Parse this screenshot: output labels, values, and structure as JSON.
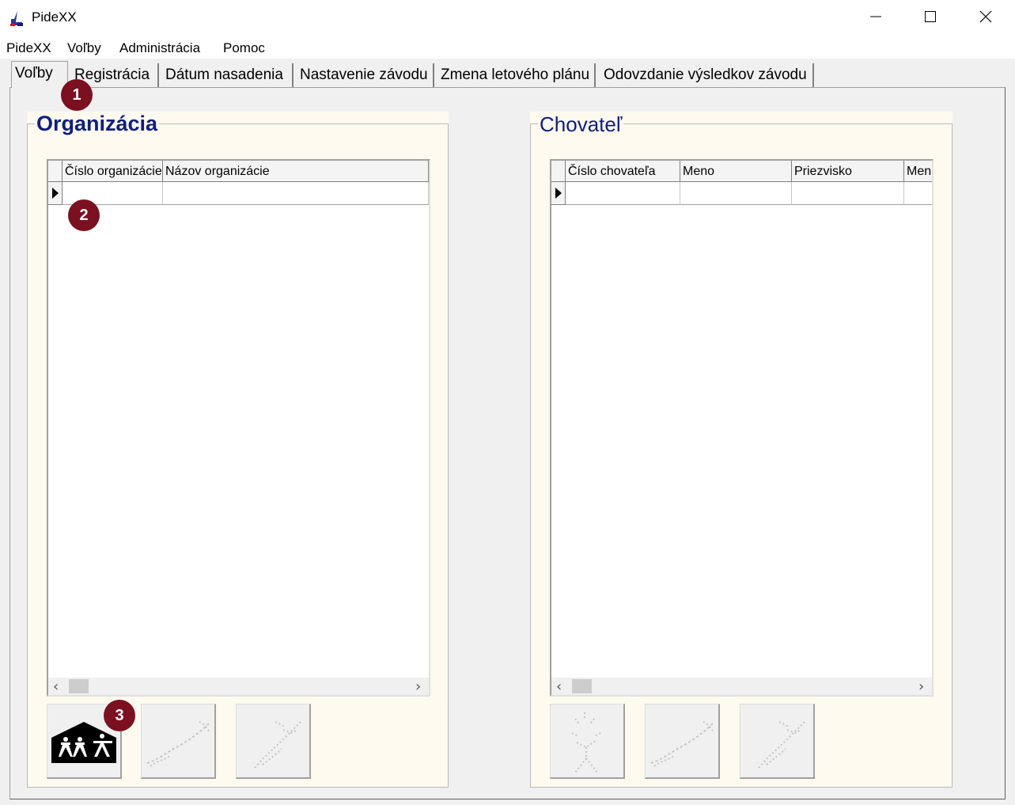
{
  "window": {
    "title": "PideXX",
    "minimize_icon": "minimize-icon",
    "maximize_icon": "maximize-icon",
    "close_icon": "close-icon"
  },
  "menu": [
    "PideXX",
    "Voľby",
    "Administrácia",
    "Pomoc"
  ],
  "tabs": [
    {
      "label": "Voľby",
      "active": true
    },
    {
      "label": "Registrácia"
    },
    {
      "label": "Dátum nasadenia"
    },
    {
      "label": "Nastavenie závodu"
    },
    {
      "label": "Zmena letového plánu"
    },
    {
      "label": "Odovzdanie výsledkov závodu"
    }
  ],
  "organizacia": {
    "title": "Organizácia",
    "columns": [
      "Číslo organizácie",
      "Názov organizácie"
    ],
    "buttons": [
      "add-organization-icon",
      "pigeon-icon",
      "bird-flight-icon"
    ]
  },
  "chovatel": {
    "title": "Chovateľ",
    "columns": [
      "Číslo chovateľa",
      "Meno",
      "Priezvisko",
      "Men"
    ],
    "buttons": [
      "person-icon",
      "pigeon-icon",
      "bird-flight-icon"
    ]
  },
  "badges": [
    "1",
    "2",
    "3"
  ],
  "colors": {
    "group_title": "#0f1f7a",
    "panel_bg": "#fffaf0",
    "badge": "#7a1020"
  }
}
